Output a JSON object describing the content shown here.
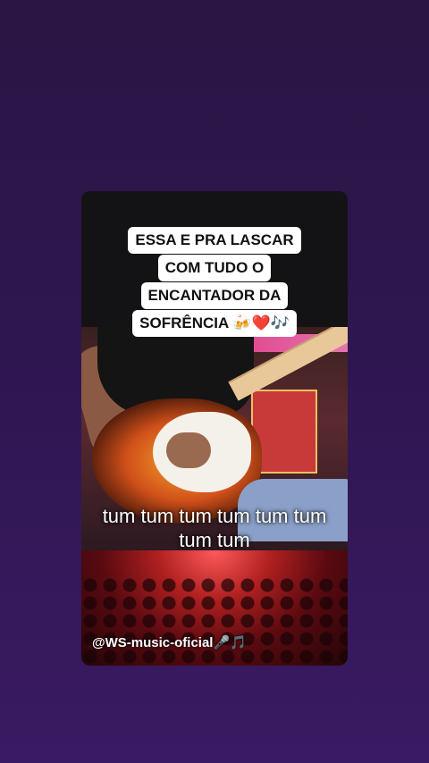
{
  "caption": {
    "lines": [
      "ESSA E PRA LASCAR",
      "COM TUDO O",
      "ENCANTADOR DA",
      "SOFRÊNCIA 🍻❤️🎶"
    ]
  },
  "lyrics": {
    "line1": "tum tum tum tum tum tum",
    "line2": "tum tum"
  },
  "watermark": "@WS-music-oficial🎤🎵",
  "colors": {
    "background": "#2e1650",
    "caption_bg": "#ffffff",
    "caption_text": "#111111",
    "lyrics_text": "#ffffff"
  }
}
